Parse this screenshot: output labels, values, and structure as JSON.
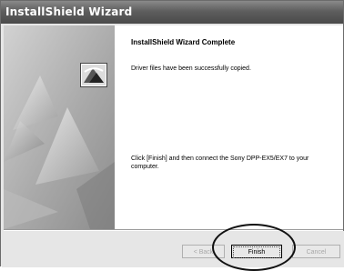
{
  "window": {
    "title": "InstallShield Wizard"
  },
  "content": {
    "heading": "InstallShield Wizard Complete",
    "subtext": "Driver files have been successfully copied.",
    "instruction": "Click [Finish] and then connect the Sony DPP-EX5/EX7 to your computer."
  },
  "buttons": {
    "back_label": "< Back",
    "finish_label": "Finish",
    "cancel_label": "Cancel"
  },
  "colors": {
    "titlebar": "#5e5e5e",
    "sidepanel": "#b8b8b8",
    "background": "#e6e6e6"
  },
  "icons": {
    "wizard_logo": "installshield-logo-icon"
  }
}
